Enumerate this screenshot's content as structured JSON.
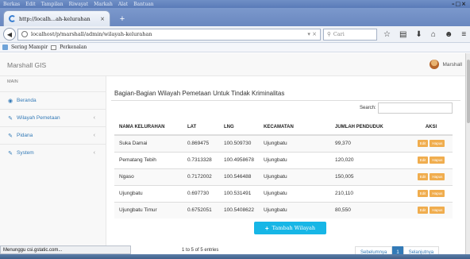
{
  "browser": {
    "menu": [
      "Berkas",
      "Edit",
      "Tampilan",
      "Riwayat",
      "Markah",
      "Alat",
      "Bantuan"
    ],
    "window_controls": "–□×",
    "tab_title": "http://localh...ah-kelurahan",
    "tab_close": "×",
    "new_tab": "+",
    "url": "localhost/p/marshall/admin/wilayah-kelurahan",
    "url_controls": "▾ ×",
    "search_placeholder": "Cari",
    "bookmarks": [
      "Sering Mampir",
      "Perkenalan"
    ]
  },
  "app": {
    "brand": "Marshall GIS",
    "user": "Marshall"
  },
  "sidebar": {
    "heading": "MAIN",
    "items": [
      {
        "label": "Beranda",
        "icon": "dashboard-icon"
      },
      {
        "label": "Wilayah Pemetaan",
        "icon": "edit-icon"
      },
      {
        "label": "Pidana",
        "icon": "edit-icon"
      },
      {
        "label": "System",
        "icon": "edit-icon"
      }
    ]
  },
  "main": {
    "title": "Bagian-Bagian Wilayah Pemetaan Untuk Tindak Kriminalitas",
    "search_label": "Search:",
    "columns": [
      "NAMA KELURAHAN",
      "LAT",
      "LNG",
      "KECAMATAN",
      "JUMLAH PENDUDUK",
      "AKSI"
    ],
    "rows": [
      {
        "nama": "Suka Damai",
        "lat": "0.869475",
        "lng": "100.509730",
        "kecamatan": "Ujungbatu",
        "penduduk": "99,370"
      },
      {
        "nama": "Pematang Tebih",
        "lat": "0.7313328",
        "lng": "100.4958678",
        "kecamatan": "Ujungbatu",
        "penduduk": "120,020"
      },
      {
        "nama": "Ngaso",
        "lat": "0.7172002",
        "lng": "100.546488",
        "kecamatan": "Ujungbatu",
        "penduduk": "150,005"
      },
      {
        "nama": "Ujungbatu",
        "lat": "0.697730",
        "lng": "100.531491",
        "kecamatan": "Ujungbatu",
        "penduduk": "210,110"
      },
      {
        "nama": "Ujungbatu Timur",
        "lat": "0.6752051",
        "lng": "100.5408622",
        "kecamatan": "Ujungbatu",
        "penduduk": "80,550"
      }
    ],
    "edit_label": "Edit",
    "hapus_label": "Hapus",
    "add_button": "Tambah Wilayah",
    "info": "1 to 5 of 5 entries",
    "pager": {
      "prev": "Sebelumnya",
      "current": "1",
      "next": "Selanjutnya"
    }
  },
  "status": {
    "text": "Menunggu csi.gstatic.com..."
  }
}
